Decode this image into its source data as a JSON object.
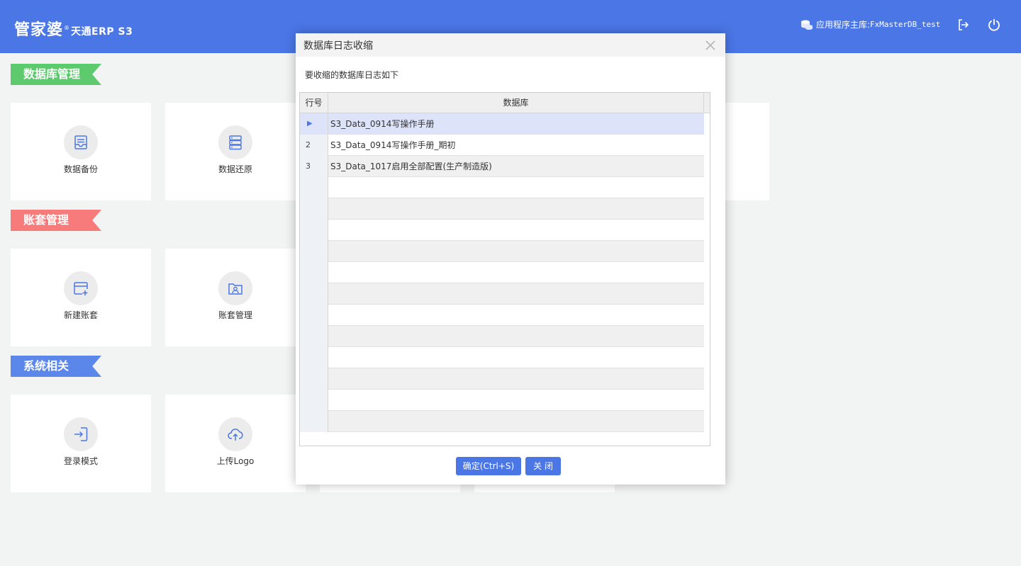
{
  "header": {
    "logo_text": "管家婆",
    "logo_mark": "®",
    "logo_sub": "天通ERP S3",
    "db_label": "应用程序主库:",
    "db_name": "FxMasterDB_test",
    "bg_color": "#4a76e6"
  },
  "sections": [
    {
      "title": "数据库管理",
      "color": "#5cca6d"
    },
    {
      "title": "账套管理",
      "color": "#f77b7b"
    },
    {
      "title": "系统相关",
      "color": "#5b86ea"
    }
  ],
  "tiles": [
    {
      "label": "数据备份",
      "icon": "inbox-icon"
    },
    {
      "label": "数据还原",
      "icon": "server-icon"
    },
    {
      "label": "新建账套",
      "icon": "add-window-icon"
    },
    {
      "label": "账套管理",
      "icon": "folder-user-icon"
    },
    {
      "label": "登录模式",
      "icon": "login-icon"
    },
    {
      "label": "上传Logo",
      "icon": "cloud-upload-icon"
    }
  ],
  "dialog": {
    "title": "数据库日志收缩",
    "hint": "要收缩的数据库日志如下",
    "columns": {
      "row_no": "行号",
      "database": "数据库"
    },
    "rows": [
      {
        "no": "▶",
        "database": "S3_Data_0914写操作手册"
      },
      {
        "no": "2",
        "database": "S3_Data_0914写操作手册_期初"
      },
      {
        "no": "3",
        "database": "S3_Data_1017启用全部配置(生产制造版)"
      }
    ],
    "ok_label": "确定(Ctrl+S)",
    "close_label": "关 闭"
  }
}
